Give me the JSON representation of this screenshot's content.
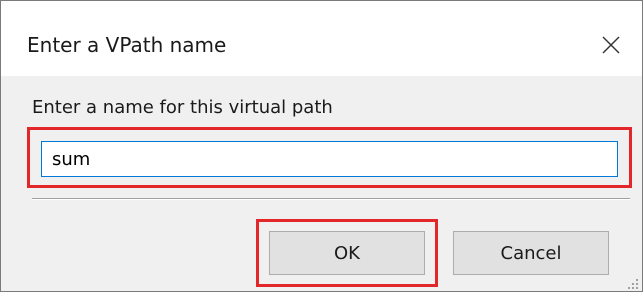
{
  "dialog": {
    "title": "Enter a VPath name",
    "prompt": "Enter a name for this virtual path",
    "input": {
      "value": "sum"
    },
    "buttons": {
      "ok_label": "OK",
      "cancel_label": "Cancel"
    },
    "icons": {
      "close": "close-icon",
      "resize": "resize-grip-icon"
    },
    "colors": {
      "highlight": "#e3262a",
      "focus_border": "#0078d7",
      "client_background": "#f0f0f0",
      "button_face": "#e1e1e1"
    }
  }
}
